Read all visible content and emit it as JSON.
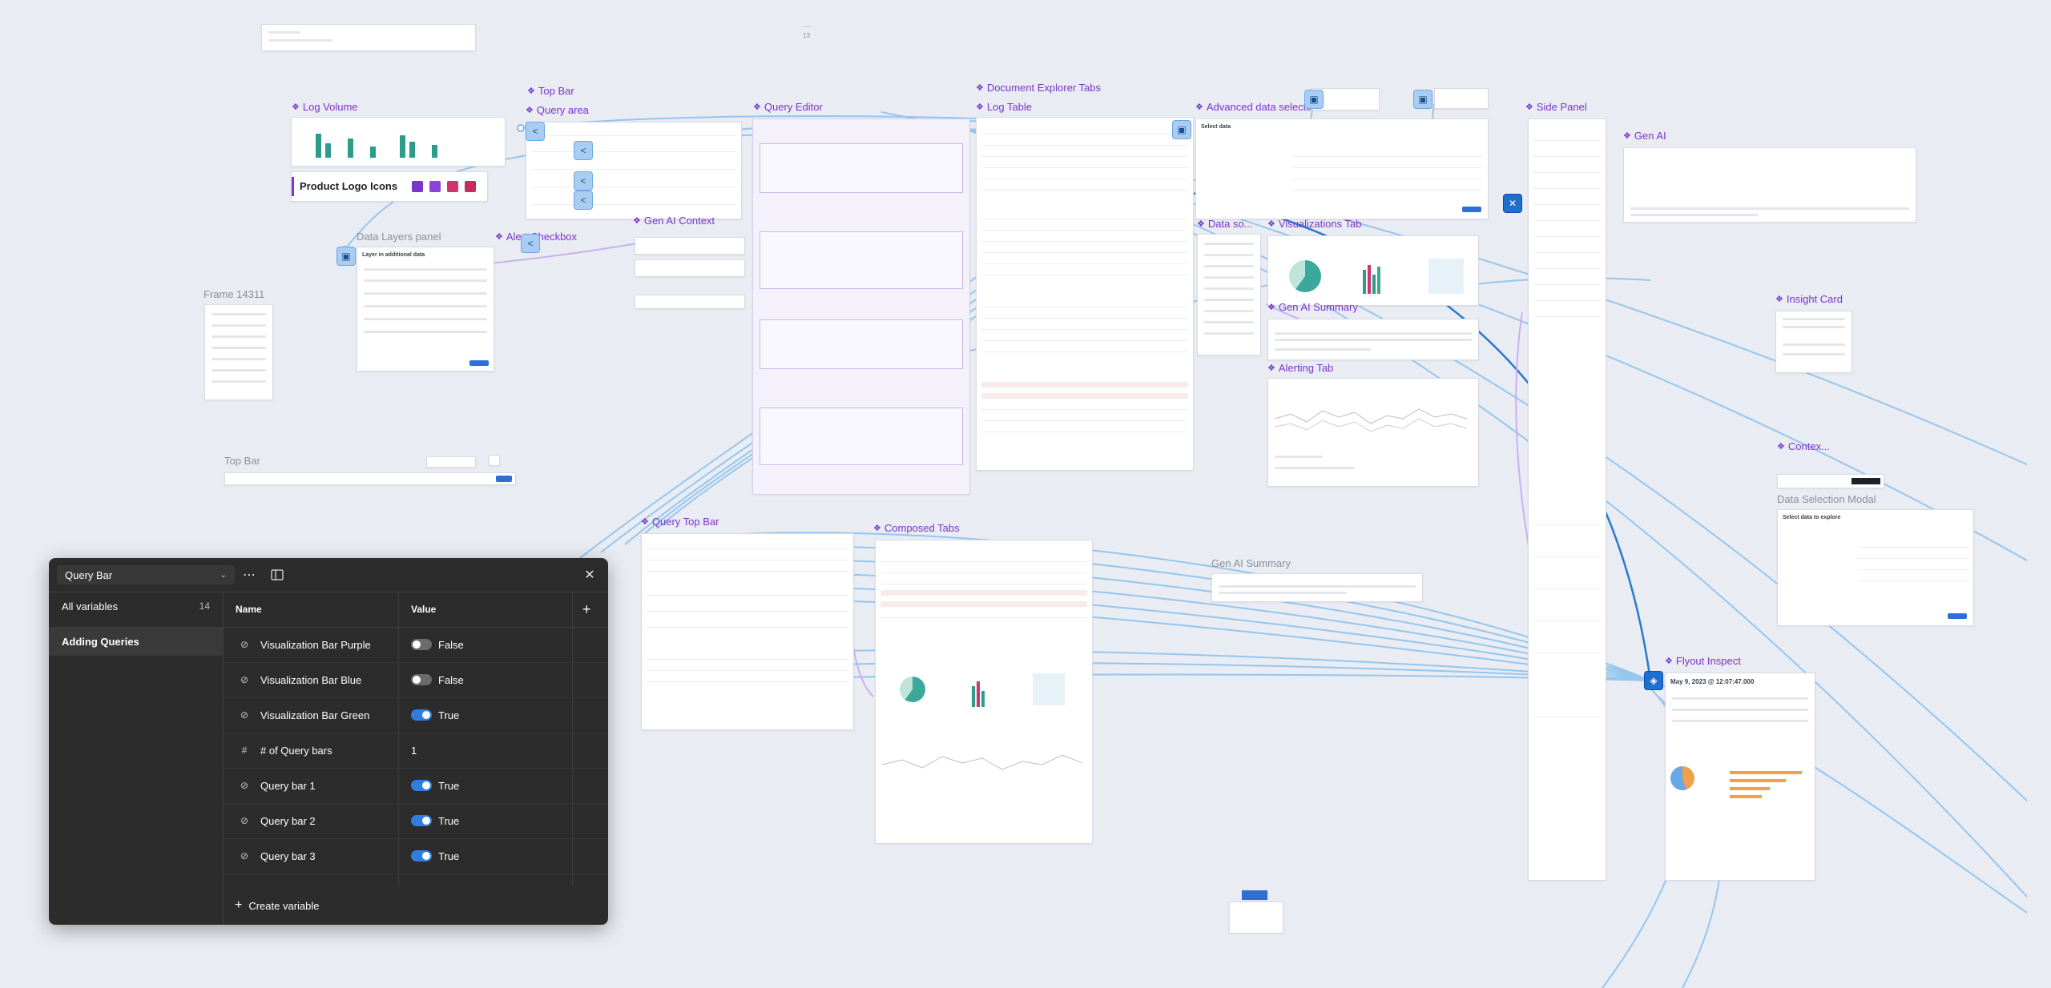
{
  "canvas": {
    "frames": {
      "log_volume": "Log Volume",
      "top_bar_top": "Top Bar",
      "query_area": "Query area",
      "query_editor": "Query Editor",
      "document_explorer_tabs": "Document Explorer Tabs",
      "log_table": "Log Table",
      "advanced_data_selector": "Advanced data selector",
      "side_panel": "Side Panel",
      "gen_ai": "Gen AI",
      "product_logo_icons": "Product Logo Icons",
      "data_layers_panel": "Data Layers panel",
      "alert_checkbox": "Alert Checkbox",
      "gen_ai_context": "Gen AI Context",
      "data_source": "Data so...",
      "visualizations_tab": "Visualizations Tab",
      "gen_ai_summary": "Gen AI Summary",
      "alerting_tab": "Alerting Tab",
      "insight_card": "Insight Card",
      "frame_14311": "Frame 14311",
      "top_bar_bottom": "Top Bar",
      "context": "Contex...",
      "data_selection_modal": "Data Selection Modal",
      "query_top_bar": "Query Top Bar",
      "composed_tabs": "Composed Tabs",
      "gen_ai_summary_2": "Gen AI Summary",
      "flyout_inspect": "Flyout Inspect"
    },
    "snippets": {
      "data_layers_title": "Layer in additional data",
      "select_data_title": "Select data",
      "flyout_time": "May 9, 2023 @ 12:07:47.000",
      "data_selection_modal_title": "Select data to explore",
      "ellipsis": "...",
      "top_small_number": "13"
    },
    "icons": {
      "component": "component-icon",
      "flow_node": "flow-node-icon",
      "doc_node": "document-node-icon",
      "close_node": "close-node-icon"
    },
    "colors": {
      "canvas_bg": "#e9ecf3",
      "component_purple": "#7b35c9",
      "wire_blue": "#8cc2ee",
      "wire_dark": "#2879d0",
      "wire_lilac": "#c9a9ef",
      "teal_chart": "#2e9c8a",
      "toggle_on": "#2f7de1"
    }
  },
  "variables_panel": {
    "collection": "Query Bar",
    "modes": [
      {
        "label": "All variables",
        "count": "14"
      },
      {
        "label": "Adding Queries",
        "count": ""
      }
    ],
    "columns": {
      "name": "Name",
      "value": "Value"
    },
    "rows": [
      {
        "name": "Visualization Bar Purple",
        "type": "boolean",
        "value": "False",
        "on": false
      },
      {
        "name": "Visualization Bar Blue",
        "type": "boolean",
        "value": "False",
        "on": false
      },
      {
        "name": "Visualization Bar Green",
        "type": "boolean",
        "value": "True",
        "on": true
      },
      {
        "name": "# of Query bars",
        "type": "number",
        "value": "1",
        "on": null
      },
      {
        "name": "Query bar 1",
        "type": "boolean",
        "value": "True",
        "on": true
      },
      {
        "name": "Query bar 2",
        "type": "boolean",
        "value": "True",
        "on": true
      },
      {
        "name": "Query bar 3",
        "type": "boolean",
        "value": "True",
        "on": true
      }
    ],
    "create_label": "Create variable"
  }
}
